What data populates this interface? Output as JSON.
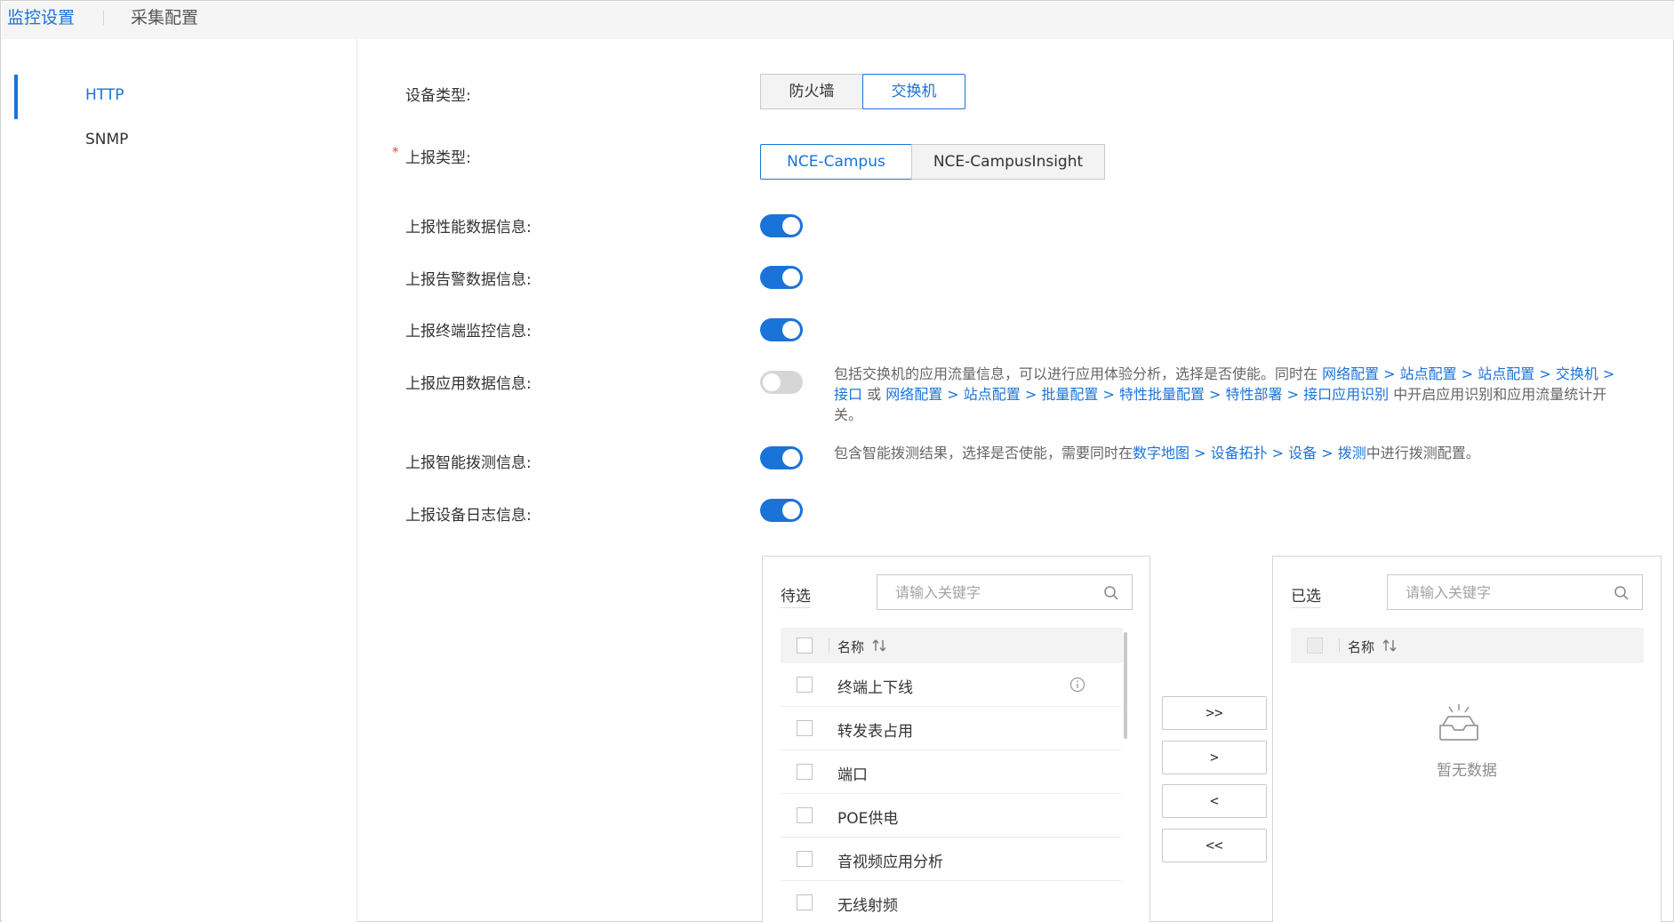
{
  "top_tabs": {
    "monitor": "监控设置",
    "collect": "采集配置"
  },
  "nav": {
    "http": "HTTP",
    "snmp": "SNMP"
  },
  "form": {
    "device_type": {
      "label": "设备类型:",
      "options": [
        "防火墙",
        "交换机"
      ],
      "selected": "交换机"
    },
    "report_type": {
      "label": "上报类型:",
      "options": [
        "NCE-Campus",
        "NCE-CampusInsight"
      ],
      "selected": "NCE-Campus"
    },
    "toggles": [
      {
        "label": "上报性能数据信息:",
        "on": true
      },
      {
        "label": "上报告警数据信息:",
        "on": true
      },
      {
        "label": "上报终端监控信息:",
        "on": true
      },
      {
        "label": "上报应用数据信息:",
        "on": false
      },
      {
        "label": "上报智能拨测信息:",
        "on": true
      },
      {
        "label": "上报设备日志信息:",
        "on": true
      }
    ],
    "app_desc": {
      "t1": "包括交换机的应用流量信息，可以进行应用体验分析，选择是否使能。同时在 ",
      "link1": "网络配置 > 站点配置 > 站点配置 > 交换机 > 接口",
      "t2": " 或 ",
      "link2": "网络配置 > 站点配置 > 批量配置 > 特性批量配置 > 特性部署 > 接口应用识别",
      "t3": " 中开启应用识别和应用流量统计开关。"
    },
    "probe_desc": {
      "t1": "包含智能拨测结果，选择是否使能，需要同时在",
      "link1": "数字地图 > 设备拓扑 > 设备 > 拨测",
      "t2": "中进行拨测配置。"
    }
  },
  "transfer": {
    "left": {
      "title": "待选",
      "search_placeholder": "请输入关键字",
      "column": "名称",
      "items": [
        "终端上下线",
        "转发表占用",
        "端口",
        "POE供电",
        "音视频应用分析",
        "无线射频"
      ]
    },
    "buttons": {
      "all_right": ">>",
      "right": ">",
      "left": "<",
      "all_left": "<<"
    },
    "right": {
      "title": "已选",
      "search_placeholder": "请输入关键字",
      "column": "名称",
      "empty_text": "暂无数据"
    }
  },
  "colors": {
    "accent": "#1a73d9",
    "toggle_off": "#d6d6d6",
    "required": "#e54545"
  },
  "icons": [
    "search-icon",
    "sort-icon",
    "info-icon",
    "empty-inbox-icon"
  ]
}
